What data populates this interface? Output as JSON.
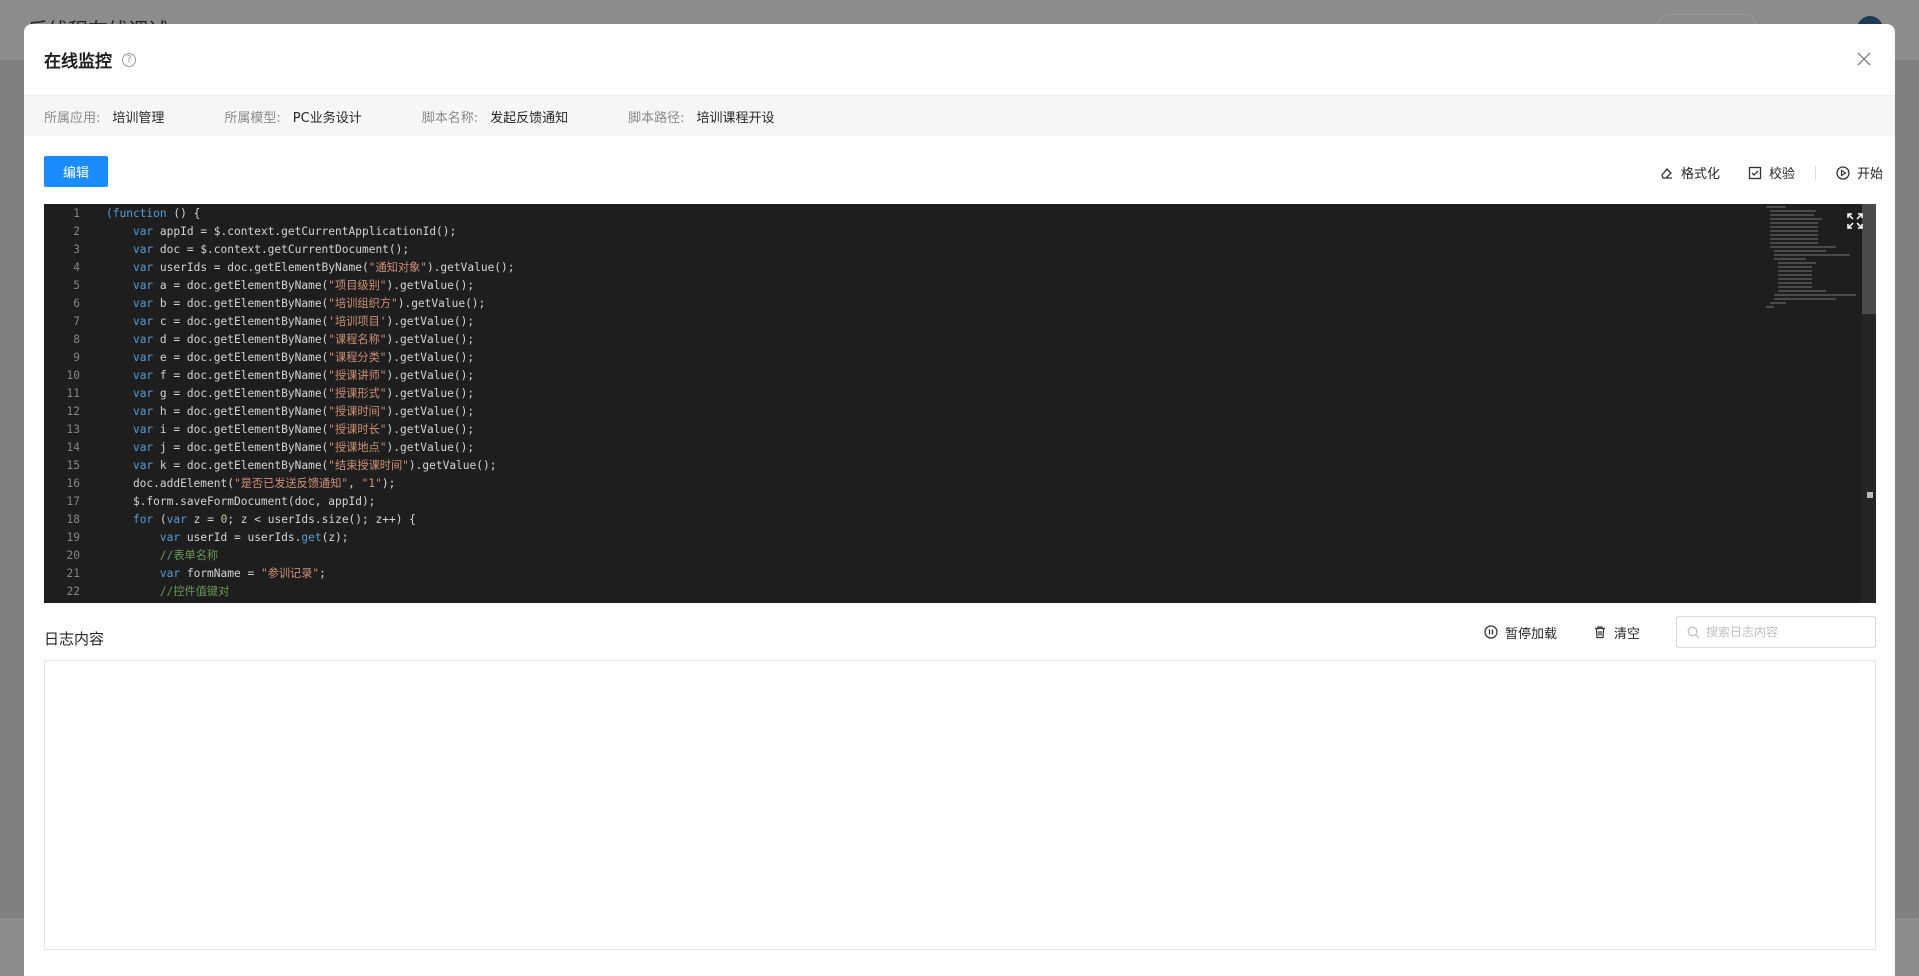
{
  "background": {
    "title": "后线程在线调试"
  },
  "modal": {
    "title": "在线监控",
    "help_icon": "question-circle-icon",
    "close_icon": "close-icon"
  },
  "meta": [
    {
      "label": "所属应用:",
      "value": "培训管理"
    },
    {
      "label": "所属模型:",
      "value": "PC业务设计"
    },
    {
      "label": "脚本名称:",
      "value": "发起反馈通知"
    },
    {
      "label": "脚本路径:",
      "value": "培训课程开设"
    }
  ],
  "toolbar": {
    "edit_label": "编辑",
    "format_label": "格式化",
    "validate_label": "校验",
    "start_label": "开始"
  },
  "editor": {
    "lines": [
      {
        "n": "1",
        "tokens": [
          [
            "kw",
            "(function"
          ],
          [
            "fn",
            " () {"
          ]
        ]
      },
      {
        "n": "2",
        "tokens": [
          [
            "fn",
            "    "
          ],
          [
            "kw",
            "var"
          ],
          [
            "fn",
            " appId = $.context.getCurrentApplicationId();"
          ]
        ]
      },
      {
        "n": "3",
        "tokens": [
          [
            "fn",
            "    "
          ],
          [
            "kw",
            "var"
          ],
          [
            "fn",
            " doc = $.context.getCurrentDocument();"
          ]
        ]
      },
      {
        "n": "4",
        "tokens": [
          [
            "fn",
            "    "
          ],
          [
            "kw",
            "var"
          ],
          [
            "fn",
            " userIds = doc.getElementByName("
          ],
          [
            "str",
            "\"通知对象\""
          ],
          [
            "fn",
            ").getValue();"
          ]
        ]
      },
      {
        "n": "5",
        "tokens": [
          [
            "fn",
            "    "
          ],
          [
            "kw",
            "var"
          ],
          [
            "fn",
            " a = doc.getElementByName("
          ],
          [
            "str",
            "\"项目级别\""
          ],
          [
            "fn",
            ").getValue();"
          ]
        ]
      },
      {
        "n": "6",
        "tokens": [
          [
            "fn",
            "    "
          ],
          [
            "kw",
            "var"
          ],
          [
            "fn",
            " b = doc.getElementByName("
          ],
          [
            "str",
            "\"培训组织方\""
          ],
          [
            "fn",
            ").getValue();"
          ]
        ]
      },
      {
        "n": "7",
        "tokens": [
          [
            "fn",
            "    "
          ],
          [
            "kw",
            "var"
          ],
          [
            "fn",
            " c = doc.getElementByName("
          ],
          [
            "str",
            "'培训项目'"
          ],
          [
            "fn",
            ").getValue();"
          ]
        ]
      },
      {
        "n": "8",
        "tokens": [
          [
            "fn",
            "    "
          ],
          [
            "kw",
            "var"
          ],
          [
            "fn",
            " d = doc.getElementByName("
          ],
          [
            "str",
            "\"课程名称\""
          ],
          [
            "fn",
            ").getValue();"
          ]
        ]
      },
      {
        "n": "9",
        "tokens": [
          [
            "fn",
            "    "
          ],
          [
            "kw",
            "var"
          ],
          [
            "fn",
            " e = doc.getElementByName("
          ],
          [
            "str",
            "\"课程分类\""
          ],
          [
            "fn",
            ").getValue();"
          ]
        ]
      },
      {
        "n": "10",
        "tokens": [
          [
            "fn",
            "    "
          ],
          [
            "kw",
            "var"
          ],
          [
            "fn",
            " f = doc.getElementByName("
          ],
          [
            "str",
            "\"授课讲师\""
          ],
          [
            "fn",
            ").getValue();"
          ]
        ]
      },
      {
        "n": "11",
        "tokens": [
          [
            "fn",
            "    "
          ],
          [
            "kw",
            "var"
          ],
          [
            "fn",
            " g = doc.getElementByName("
          ],
          [
            "str",
            "\"授课形式\""
          ],
          [
            "fn",
            ").getValue();"
          ]
        ]
      },
      {
        "n": "12",
        "tokens": [
          [
            "fn",
            "    "
          ],
          [
            "kw",
            "var"
          ],
          [
            "fn",
            " h = doc.getElementByName("
          ],
          [
            "str",
            "\"授课时间\""
          ],
          [
            "fn",
            ").getValue();"
          ]
        ]
      },
      {
        "n": "13",
        "tokens": [
          [
            "fn",
            "    "
          ],
          [
            "kw",
            "var"
          ],
          [
            "fn",
            " i = doc.getElementByName("
          ],
          [
            "str",
            "\"授课时长\""
          ],
          [
            "fn",
            ").getValue();"
          ]
        ]
      },
      {
        "n": "14",
        "tokens": [
          [
            "fn",
            "    "
          ],
          [
            "kw",
            "var"
          ],
          [
            "fn",
            " j = doc.getElementByName("
          ],
          [
            "str",
            "\"授课地点\""
          ],
          [
            "fn",
            ").getValue();"
          ]
        ]
      },
      {
        "n": "15",
        "tokens": [
          [
            "fn",
            "    "
          ],
          [
            "kw",
            "var"
          ],
          [
            "fn",
            " k = doc.getElementByName("
          ],
          [
            "str",
            "\"结束授课时间\""
          ],
          [
            "fn",
            ").getValue();"
          ]
        ]
      },
      {
        "n": "16",
        "tokens": [
          [
            "fn",
            "    doc.addElement("
          ],
          [
            "str",
            "\"是否已发送反馈通知\""
          ],
          [
            "fn",
            ", "
          ],
          [
            "str",
            "\"1\""
          ],
          [
            "fn",
            ");"
          ]
        ]
      },
      {
        "n": "17",
        "tokens": [
          [
            "fn",
            "    $.form.saveFormDocument(doc, appId);"
          ]
        ]
      },
      {
        "n": "18",
        "tokens": [
          [
            "fn",
            "    "
          ],
          [
            "kw",
            "for"
          ],
          [
            "fn",
            " ("
          ],
          [
            "kw",
            "var"
          ],
          [
            "fn",
            " z = "
          ],
          [
            "num",
            "0"
          ],
          [
            "fn",
            "; z < userIds.size(); z++) {"
          ]
        ]
      },
      {
        "n": "19",
        "tokens": [
          [
            "fn",
            "        "
          ],
          [
            "kw",
            "var"
          ],
          [
            "fn",
            " userId = userIds."
          ],
          [
            "kw",
            "get"
          ],
          [
            "fn",
            "(z);"
          ]
        ]
      },
      {
        "n": "20",
        "tokens": [
          [
            "cm",
            "        //表单名称"
          ]
        ]
      },
      {
        "n": "21",
        "tokens": [
          [
            "fn",
            "        "
          ],
          [
            "kw",
            "var"
          ],
          [
            "fn",
            " formName = "
          ],
          [
            "str",
            "\"参训记录\""
          ],
          [
            "fn",
            ";"
          ]
        ]
      },
      {
        "n": "22",
        "tokens": [
          [
            "cm",
            "        //控件值键对"
          ]
        ]
      }
    ]
  },
  "log": {
    "title": "日志内容",
    "pause_label": "暂停加载",
    "clear_label": "清空",
    "search_placeholder": "搜索日志内容",
    "search_value": ""
  },
  "colors": {
    "primary": "#1a8cff",
    "editor_bg": "#1e1e1e",
    "keyword": "#569cd6",
    "string": "#ce9178",
    "comment": "#6a9955"
  }
}
